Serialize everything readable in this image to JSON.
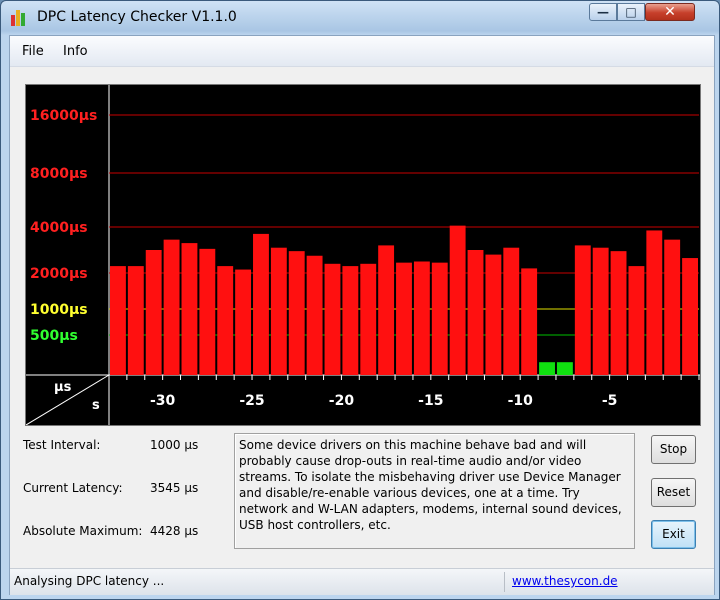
{
  "window": {
    "title": "DPC Latency Checker V1.1.0",
    "controls": {
      "minimize": "—",
      "maximize": "□",
      "close": "✕"
    }
  },
  "menu": {
    "items": [
      "File",
      "Info"
    ]
  },
  "chart_data": {
    "type": "bar",
    "y_unit_label": "µs",
    "x_unit_label": "s",
    "y_ticks": [
      {
        "label": "16000µs",
        "color": "#ff2020"
      },
      {
        "label": "8000µs",
        "color": "#ff2020"
      },
      {
        "label": "4000µs",
        "color": "#ff2020"
      },
      {
        "label": "2000µs",
        "color": "#ff2020"
      },
      {
        "label": "1000µs",
        "color": "#ffff30"
      },
      {
        "label": "500µs",
        "color": "#30ff30"
      }
    ],
    "x_ticks": [
      "-30",
      "-25",
      "-20",
      "-15",
      "-10",
      "-5"
    ],
    "x_tick_values": [
      -30,
      -25,
      -20,
      -15,
      -10,
      -5
    ],
    "xlim": [
      -33,
      0
    ],
    "x_values": [
      -32,
      -31,
      -30,
      -29,
      -28,
      -27,
      -26,
      -25,
      -24,
      -23,
      -22,
      -21,
      -20,
      -19,
      -18,
      -17,
      -16,
      -15,
      -14,
      -13,
      -12,
      -11,
      -10,
      -9,
      -8,
      -7,
      -6,
      -5,
      -4,
      -3,
      -2,
      -1
    ],
    "values": [
      2300,
      2300,
      3000,
      3450,
      3300,
      3050,
      2300,
      2150,
      3700,
      3100,
      2950,
      2750,
      2400,
      2300,
      2400,
      3200,
      2450,
      2500,
      2450,
      4100,
      3000,
      2800,
      3100,
      2200,
      160,
      160,
      3200,
      3100,
      2950,
      2300,
      3850,
      3450,
      2650
    ],
    "colors": {
      "high": "#ff1010",
      "ok": "#10e010",
      "gridline_red": "#c80000",
      "gridline_yellow": "#e0e000",
      "gridline_green": "#00c000"
    }
  },
  "stats": {
    "test_interval_label": "Test Interval:",
    "test_interval_value": "1000 µs",
    "current_latency_label": "Current Latency:",
    "current_latency_value": "3545 µs",
    "absolute_max_label": "Absolute Maximum:",
    "absolute_max_value": "4428 µs"
  },
  "message": "Some device drivers on this machine behave bad and will probably cause drop-outs in real-time audio and/or video streams. To isolate the misbehaving driver use Device Manager and disable/re-enable various devices, one at a time. Try network and W-LAN adapters, modems, internal sound devices, USB host controllers, etc.",
  "buttons": {
    "stop": "Stop",
    "reset": "Reset",
    "exit": "Exit"
  },
  "status": {
    "text": "Analysing DPC latency ...",
    "link": "www.thesycon.de"
  }
}
